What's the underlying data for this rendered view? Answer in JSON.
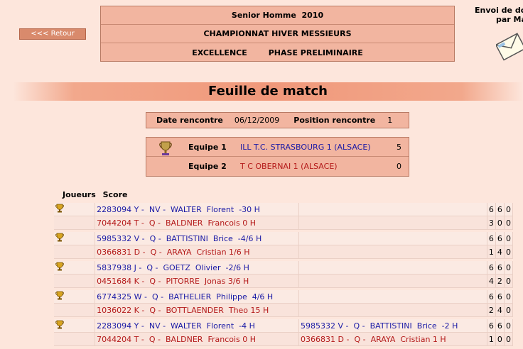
{
  "nav": {
    "back_label": "<<< Retour"
  },
  "header": {
    "line1": "Senior Homme  2010",
    "line2": "CHAMPIONNAT HIVER MESSIEURS",
    "line3a": "EXCELLENCE",
    "line3b": "PHASE PRELIMINAIRE"
  },
  "envoi": {
    "line1": "Envoi de do",
    "line2": "par Ma"
  },
  "title": "Feuille de match",
  "rencontre": {
    "date_label": "Date rencontre",
    "date": "06/12/2009",
    "position_label": "Position rencontre",
    "position": "1"
  },
  "teams": [
    {
      "label": "Equipe 1",
      "name": "ILL T.C. STRASBOURG 1 (ALSACE)",
      "score": "5"
    },
    {
      "label": "Equipe 2",
      "name": "T C OBERNAI 1 (ALSACE)",
      "score": "0"
    }
  ],
  "columns": {
    "joueurs": "Joueurs",
    "score": "Score"
  },
  "matches": [
    {
      "p1a": "2283094 Y -  NV -  WALTER  Florent  -30 H",
      "p2a": "",
      "s1": [
        "6",
        "6",
        "0"
      ],
      "p1b": "7044204 T -  Q -  BALDNER  Francois 0 H",
      "p2b": "",
      "s2": [
        "3",
        "0",
        "0"
      ]
    },
    {
      "p1a": "5985332 V -  Q -  BATTISTINI  Brice  -4/6 H",
      "p2a": "",
      "s1": [
        "6",
        "6",
        "0"
      ],
      "p1b": "0366831 D -  Q -  ARAYA  Cristian 1/6 H",
      "p2b": "",
      "s2": [
        "1",
        "4",
        "0"
      ]
    },
    {
      "p1a": "5837938 J -  Q -  GOETZ  Olivier  -2/6 H",
      "p2a": "",
      "s1": [
        "6",
        "6",
        "0"
      ],
      "p1b": "0451684 K -  Q -  PITORRE  Jonas 3/6 H",
      "p2b": "",
      "s2": [
        "4",
        "2",
        "0"
      ]
    },
    {
      "p1a": "6774325 W -  Q -  BATHELIER  Philippe  4/6 H",
      "p2a": "",
      "s1": [
        "6",
        "6",
        "0"
      ],
      "p1b": "1036022 K -  Q -  BOTTLAENDER  Theo 15 H",
      "p2b": "",
      "s2": [
        "2",
        "4",
        "0"
      ]
    },
    {
      "p1a": "2283094 Y -  NV -  WALTER  Florent  -4 H",
      "p2a": "5985332 V -  Q -  BATTISTINI  Brice  -2 H",
      "s1": [
        "6",
        "6",
        "0"
      ],
      "p1b": "7044204 T -  Q -  BALDNER  Francois 0 H",
      "p2b": "0366831 D -  Q -  ARAYA  Cristian 1 H",
      "s2": [
        "1",
        "0",
        "0"
      ]
    }
  ]
}
